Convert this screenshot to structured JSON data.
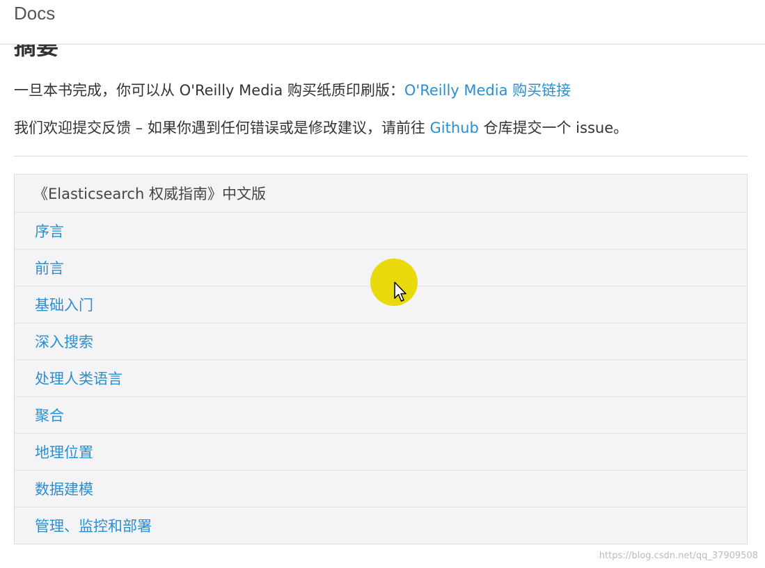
{
  "header": {
    "brand": "Docs"
  },
  "section": {
    "heading": "摘要",
    "para1": {
      "text": "一旦本书完成，你可以从 O'Reilly Media 购买纸质印刷版：",
      "link": "O'Reilly Media 购买链接"
    },
    "para2": {
      "text_before": "我们欢迎提交反馈 – 如果你遇到任何错误或是修改建议，请前往 ",
      "link": "Github",
      "text_after": " 仓库提交一个 issue。"
    }
  },
  "toc": {
    "title": "《Elasticsearch 权威指南》中文版",
    "items": [
      "序言",
      "前言",
      "基础入门",
      "深入搜索",
      "处理人类语言",
      "聚合",
      "地理位置",
      "数据建模",
      "管理、监控和部署"
    ]
  },
  "overlay": {
    "cursor_icon": "arrow-cursor-icon",
    "highlight_color": "#e8da0c"
  },
  "watermark": "https://blog.csdn.net/qq_37909508"
}
